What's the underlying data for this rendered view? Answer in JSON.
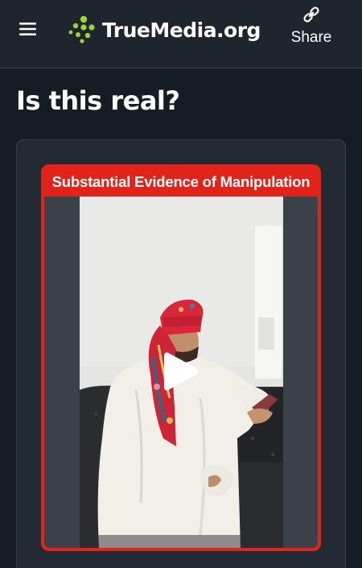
{
  "header": {
    "brand": "TrueMedia.org",
    "share_label": "Share"
  },
  "main": {
    "title": "Is this real?",
    "result": {
      "verdict": "Substantial Evidence of Manipulation"
    }
  },
  "colors": {
    "background": "#161c24",
    "header_bg": "#1e252e",
    "card_bg": "#232a33",
    "brand_green": "#9ad43b",
    "verdict_red": "#e2231a"
  },
  "icons": {
    "menu": "hamburger-menu-icon",
    "share": "link-icon",
    "play": "play-icon"
  }
}
